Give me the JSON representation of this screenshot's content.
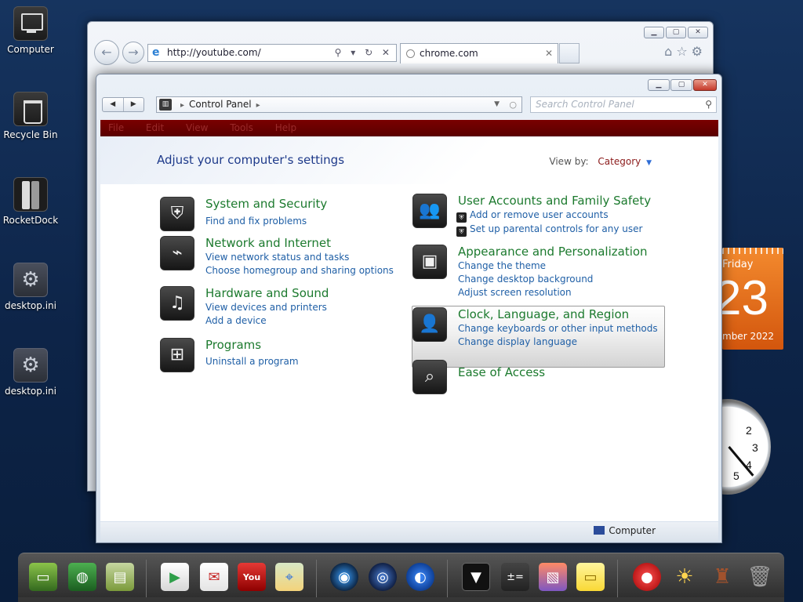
{
  "desktop": {
    "icons": [
      {
        "label": "Computer",
        "icon": "computer-icon"
      },
      {
        "label": "Recycle Bin",
        "icon": "recycle-bin-icon"
      },
      {
        "label": "RocketDock",
        "icon": "rocketdock-icon"
      },
      {
        "label": "desktop.ini",
        "icon": "gear-icon"
      },
      {
        "label": "desktop.ini",
        "icon": "gear-icon"
      }
    ]
  },
  "browser": {
    "url": "http://youtube.com/",
    "tab_title": "chrome.com",
    "tab_close": "✕",
    "address_tools": "⚲ ▾ ↻ ✕"
  },
  "control_panel": {
    "breadcrumb": "Control Panel",
    "search_placeholder": "Search Control Panel",
    "menu": [
      "File",
      "Edit",
      "View",
      "Tools",
      "Help"
    ],
    "heading": "Adjust your computer's settings",
    "view_by_label": "View by:",
    "view_by_value": "Category",
    "categories": [
      {
        "title": "System and Security",
        "links": [
          "Find and fix problems"
        ],
        "icon": "shield-icon"
      },
      {
        "title": "Network and Internet",
        "links": [
          "View network status and tasks",
          "Choose homegroup and sharing options"
        ],
        "icon": "network-router-icon"
      },
      {
        "title": "Hardware and Sound",
        "links": [
          "View devices and printers",
          "Add a device"
        ],
        "icon": "music-note-icon"
      },
      {
        "title": "Programs",
        "links": [
          "Uninstall a program"
        ],
        "icon": "windows-logo-icon"
      },
      {
        "title": "User Accounts and Family Safety",
        "links": [
          "Add or remove user accounts",
          "Set up parental controls for any user"
        ],
        "icon": "users-icon"
      },
      {
        "title": "Appearance and Personalization",
        "links": [
          "Change the theme",
          "Change desktop background",
          "Adjust screen resolution"
        ],
        "icon": "display-icon"
      },
      {
        "title": "Clock, Language, and Region",
        "links": [
          "Change keyboards or other input methods",
          "Change display language"
        ],
        "icon": "clock-region-icon"
      },
      {
        "title": "Ease of Access",
        "links": [],
        "icon": "ease-of-access-icon"
      }
    ],
    "status_computer": "Computer"
  },
  "calendar": {
    "day_name": "Friday",
    "day_number": "23",
    "month_year": "mber 2022"
  },
  "clock": {
    "numbers": [
      "2",
      "3",
      "4",
      "5"
    ]
  },
  "dock": {
    "items": [
      "android-desktop-icon",
      "world-map-icon",
      "android-folder-icon",
      "play-store-icon",
      "gmail-icon",
      "youtube-icon",
      "maps-icon",
      "camera-lens-icon",
      "speaker-icon",
      "globe-icon",
      "tv-icon",
      "calculator-icon",
      "photo-icon",
      "sticky-note-icon",
      "angry-birds-icon",
      "weather-icon",
      "android-robot-icon",
      "trash-icon"
    ]
  }
}
